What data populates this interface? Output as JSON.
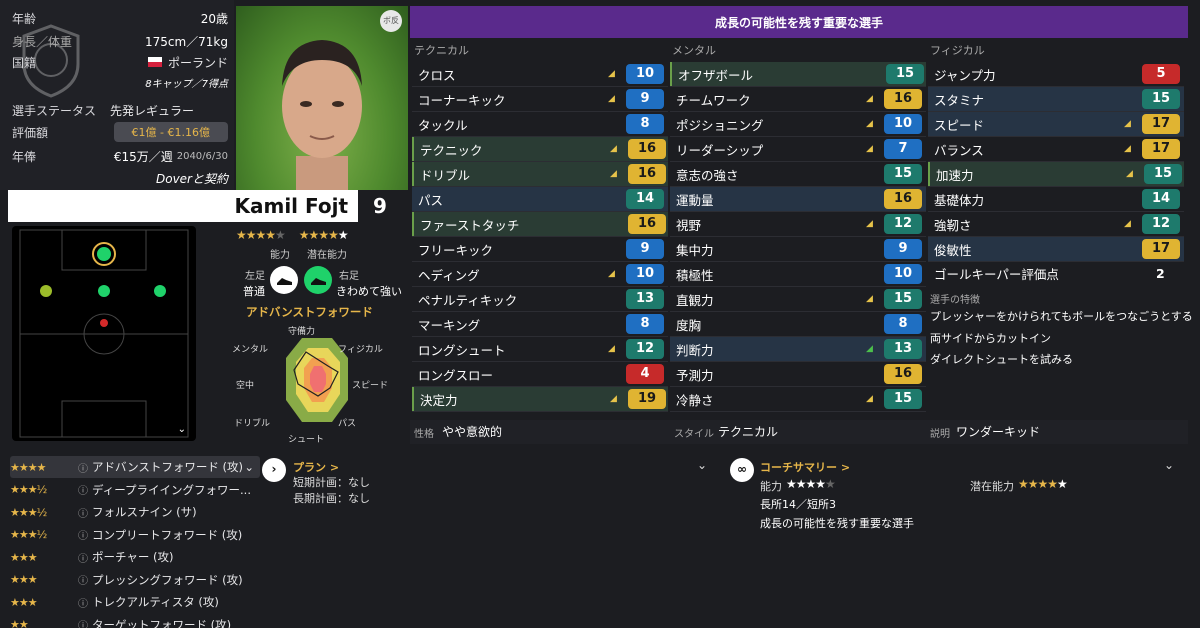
{
  "info": {
    "age_label": "年齢",
    "age": "20歳",
    "height_label": "身長／体重",
    "height": "175cm／71kg",
    "nation_label": "国籍",
    "nation": "ポーランド",
    "caps": "8キャップ／7得点",
    "status_label": "選手ステータス",
    "status": "先発レギュラー",
    "value_label": "評価額",
    "value": "€1億 - €1.16億",
    "wage_label": "年俸",
    "wage": "€15万／週",
    "contract_end": "2040/6/30",
    "contract": "Doverと契約"
  },
  "photo_badge": "ボ反",
  "player": {
    "name": "Kamil Fojt",
    "number": "9"
  },
  "ability": {
    "ca_label": "能力",
    "pa_label": "潜在能力",
    "ca_stars": 4,
    "pa_stars": 5
  },
  "feet": {
    "left_label": "左足",
    "left_value": "普通",
    "right_label": "右足",
    "right_value": "きわめて強い"
  },
  "role_name": "アドバンストフォワード",
  "radar": {
    "labels": [
      "守備力",
      "フィジカル",
      "スピード",
      "パス",
      "シュート",
      "ドリブル",
      "空中",
      "メンタル"
    ]
  },
  "header": {
    "title": "成長の可能性を残す重要な選手"
  },
  "columns": {
    "technical": "テクニカル",
    "mental": "メンタル",
    "physical": "フィジカル"
  },
  "technical": [
    {
      "name": "クロス",
      "value": "10",
      "color": "blue",
      "arrow": true
    },
    {
      "name": "コーナーキック",
      "value": "9",
      "color": "blue",
      "arrow": true
    },
    {
      "name": "タックル",
      "value": "8",
      "color": "blue",
      "arrow": false
    },
    {
      "name": "テクニック",
      "value": "16",
      "color": "gold",
      "arrow": true,
      "hl": "green"
    },
    {
      "name": "ドリブル",
      "value": "16",
      "color": "gold",
      "arrow": true,
      "hl": "green"
    },
    {
      "name": "パス",
      "value": "14",
      "color": "teal",
      "arrow": false,
      "hl": "blue"
    },
    {
      "name": "ファーストタッチ",
      "value": "16",
      "color": "gold",
      "arrow": false,
      "hl": "green"
    },
    {
      "name": "フリーキック",
      "value": "9",
      "color": "blue",
      "arrow": false
    },
    {
      "name": "ヘディング",
      "value": "10",
      "color": "blue",
      "arrow": true
    },
    {
      "name": "ペナルティキック",
      "value": "13",
      "color": "teal",
      "arrow": false
    },
    {
      "name": "マーキング",
      "value": "8",
      "color": "blue",
      "arrow": false
    },
    {
      "name": "ロングシュート",
      "value": "12",
      "color": "teal",
      "arrow": true
    },
    {
      "name": "ロングスロー",
      "value": "4",
      "color": "red",
      "arrow": false
    },
    {
      "name": "決定力",
      "value": "19",
      "color": "gold",
      "arrow": true,
      "hl": "green"
    }
  ],
  "mental": [
    {
      "name": "オフザボール",
      "value": "15",
      "color": "teal",
      "arrow": false,
      "hl": "green"
    },
    {
      "name": "チームワーク",
      "value": "16",
      "color": "gold",
      "arrow": true
    },
    {
      "name": "ポジショニング",
      "value": "10",
      "color": "blue",
      "arrow": true
    },
    {
      "name": "リーダーシップ",
      "value": "7",
      "color": "blue",
      "arrow": true
    },
    {
      "name": "意志の強さ",
      "value": "15",
      "color": "teal",
      "arrow": false
    },
    {
      "name": "運動量",
      "value": "16",
      "color": "gold",
      "arrow": false,
      "hl": "blue"
    },
    {
      "name": "視野",
      "value": "12",
      "color": "teal",
      "arrow": true
    },
    {
      "name": "集中力",
      "value": "9",
      "color": "blue",
      "arrow": false
    },
    {
      "name": "積極性",
      "value": "10",
      "color": "blue",
      "arrow": false
    },
    {
      "name": "直観力",
      "value": "15",
      "color": "teal",
      "arrow": true
    },
    {
      "name": "度胸",
      "value": "8",
      "color": "blue",
      "arrow": false
    },
    {
      "name": "判断力",
      "value": "13",
      "color": "teal",
      "arrow": true,
      "arrow_green": true,
      "hl": "blue"
    },
    {
      "name": "予測力",
      "value": "16",
      "color": "gold",
      "arrow": false
    },
    {
      "name": "冷静さ",
      "value": "15",
      "color": "teal",
      "arrow": true
    }
  ],
  "physical": [
    {
      "name": "ジャンプ力",
      "value": "5",
      "color": "red",
      "arrow": false
    },
    {
      "name": "スタミナ",
      "value": "15",
      "color": "teal",
      "arrow": false,
      "hl": "blue"
    },
    {
      "name": "スピード",
      "value": "17",
      "color": "gold",
      "arrow": true,
      "hl": "blue"
    },
    {
      "name": "バランス",
      "value": "17",
      "color": "gold",
      "arrow": true
    },
    {
      "name": "加速力",
      "value": "15",
      "color": "teal",
      "arrow": true,
      "hl": "green"
    },
    {
      "name": "基礎体力",
      "value": "14",
      "color": "teal",
      "arrow": false
    },
    {
      "name": "強靭さ",
      "value": "12",
      "color": "teal",
      "arrow": true
    },
    {
      "name": "俊敏性",
      "value": "17",
      "color": "gold",
      "arrow": false,
      "hl": "blue"
    }
  ],
  "gk_rating": {
    "label": "ゴールキーパー評価点",
    "value": "2"
  },
  "traits": {
    "title": "選手の特徴",
    "items": [
      "プレッシャーをかけられてもボールをつなごうとする",
      "両サイドからカットイン",
      "ダイレクトシュートを試みる"
    ]
  },
  "footer": {
    "personality_label": "性格",
    "personality": "やや意欲的",
    "style_label": "スタイル",
    "style": "テクニカル",
    "desc_label": "説明",
    "desc": "ワンダーキッド"
  },
  "roles": [
    {
      "stars": "★★★★",
      "name": "アドバンストフォワード (攻)"
    },
    {
      "stars": "★★★½",
      "name": "ディープライイングフォワー..."
    },
    {
      "stars": "★★★½",
      "name": "フォルスナイン (サ)"
    },
    {
      "stars": "★★★½",
      "name": "コンプリートフォワード (攻)"
    },
    {
      "stars": "★★★",
      "name": "ポーチャー (攻)"
    },
    {
      "stars": "★★★",
      "name": "プレッシングフォワード (攻)"
    },
    {
      "stars": "★★★",
      "name": "トレクアルティスタ (攻)"
    },
    {
      "stars": "★★",
      "name": "ターゲットフォワード (攻)"
    }
  ],
  "plan": {
    "title": "プラン >",
    "short": "短期計画：なし",
    "long": "長期計画：なし"
  },
  "coach": {
    "title": "コーチサマリー >",
    "ca_label": "能力",
    "pa_label": "潜在能力",
    "stats": "長所14／短所3",
    "summary": "成長の可能性を残す重要な選手"
  }
}
